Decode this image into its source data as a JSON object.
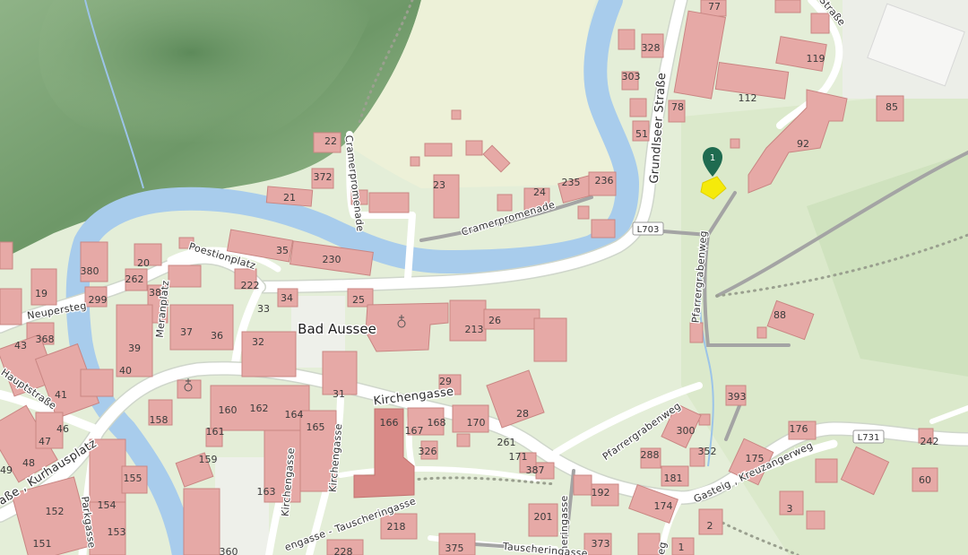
{
  "place": {
    "name": "Bad Aussee"
  },
  "marker": {
    "label": "1",
    "color": "#1f6b50",
    "highlight": "#f5ea0a"
  },
  "colors": {
    "forest": "#7fa47c",
    "grass": "#dcebc9",
    "river": "#a8ccec",
    "building": "#e6a9a6",
    "road": "#ffffff"
  },
  "route_shields": {
    "l703": "L703",
    "l731": "L731"
  },
  "streets": {
    "grundlseer": "Grundlseer Straße",
    "strasse_top": "Straße",
    "cramerpromenade_v": "Cramerpromenade",
    "cramerpromenade_h": "Cramerpromenade",
    "poestionplatz": "Poestionplatz",
    "neupersteg": "Neupersteg",
    "meranplatz": "Meranplatz",
    "hauptstrasse": "Hauptstraße",
    "kurhausplatz": "aße , Kurhausplatz",
    "parkgasse": "Parkgasse",
    "kirchengasse_main": "Kirchengasse",
    "kirchengasse_v1": "Kirchengasse",
    "kirchengasse_v2": "Kirchengasse",
    "pfarrergrabenweg_v": "Pfarrergrabenweg",
    "pfarrergrabenweg_d": "Pfarrergrabenweg",
    "gasteig": "Gasteig , Kreuzangerweg",
    "tauscheringasse_1": "engasse - Tauscheringasse",
    "tauscheringasse_2": "Tauscheringasse",
    "tauscheringasse_3": "Tauscheringasse",
    "edge_eg": "eg"
  },
  "house_numbers": {
    "n77": "77",
    "n328": "328",
    "n119": "119",
    "n303": "303",
    "n112": "112",
    "n85": "85",
    "n78": "78",
    "n51": "51",
    "n92": "92",
    "n22": "22",
    "n372": "372",
    "n21": "21",
    "n23": "23",
    "n24": "24",
    "n235": "235",
    "n236": "236",
    "n380": "380",
    "n20": "20",
    "n35": "35",
    "n230": "230",
    "n262": "262",
    "n222": "222",
    "n19": "19",
    "n299": "299",
    "n38": "38",
    "n34": "34",
    "n25": "25",
    "n33": "33",
    "n26": "26",
    "n213": "213",
    "n88": "88",
    "n368": "368",
    "n43": "43",
    "n39": "39",
    "n37": "37",
    "n36": "36",
    "n32": "32",
    "n40": "40",
    "n41": "41",
    "n29": "29",
    "n31": "31",
    "n393": "393",
    "n28": "28",
    "n158": "158",
    "n160": "160",
    "n162": "162",
    "n164": "164",
    "n166": "166",
    "n167": "167",
    "n168": "168",
    "n170": "170",
    "n176": "176",
    "n46": "46",
    "n47": "47",
    "n48": "48",
    "n49": "49",
    "n165": "165",
    "n161": "161",
    "n159": "159",
    "n155": "155",
    "n154": "154",
    "n163": "163",
    "n326": "326",
    "n261": "261",
    "n171": "171",
    "n300": "300",
    "n352": "352",
    "n387": "387",
    "n288": "288",
    "n175": "175",
    "n242": "242",
    "n60": "60",
    "n181": "181",
    "n152": "152",
    "n151": "151",
    "n153": "153",
    "n192": "192",
    "n174": "174",
    "n201": "201",
    "n218": "218",
    "n3": "3",
    "n2": "2",
    "n375": "375",
    "n373": "373",
    "n360": "360",
    "n228": "228",
    "n1": "1"
  }
}
